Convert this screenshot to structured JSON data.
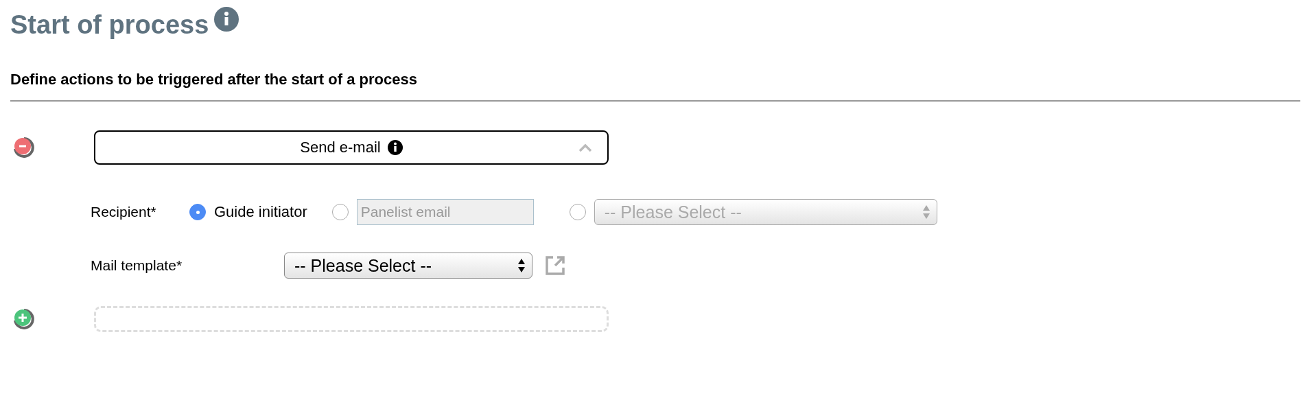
{
  "header": {
    "title": "Start of process",
    "subtitle": "Define actions to be triggered after the start of a process"
  },
  "actions": [
    {
      "title": "Send e-mail",
      "expanded": true,
      "recipient": {
        "label": "Recipient*",
        "options": [
          {
            "kind": "text",
            "label": "Guide initiator",
            "selected": true
          },
          {
            "kind": "input",
            "placeholder": "Panelist email",
            "selected": false,
            "disabled": true
          },
          {
            "kind": "select",
            "value": "-- Please Select --",
            "selected": false,
            "disabled": true
          }
        ]
      },
      "template": {
        "label": "Mail template*",
        "value": "-- Please Select --"
      }
    }
  ]
}
